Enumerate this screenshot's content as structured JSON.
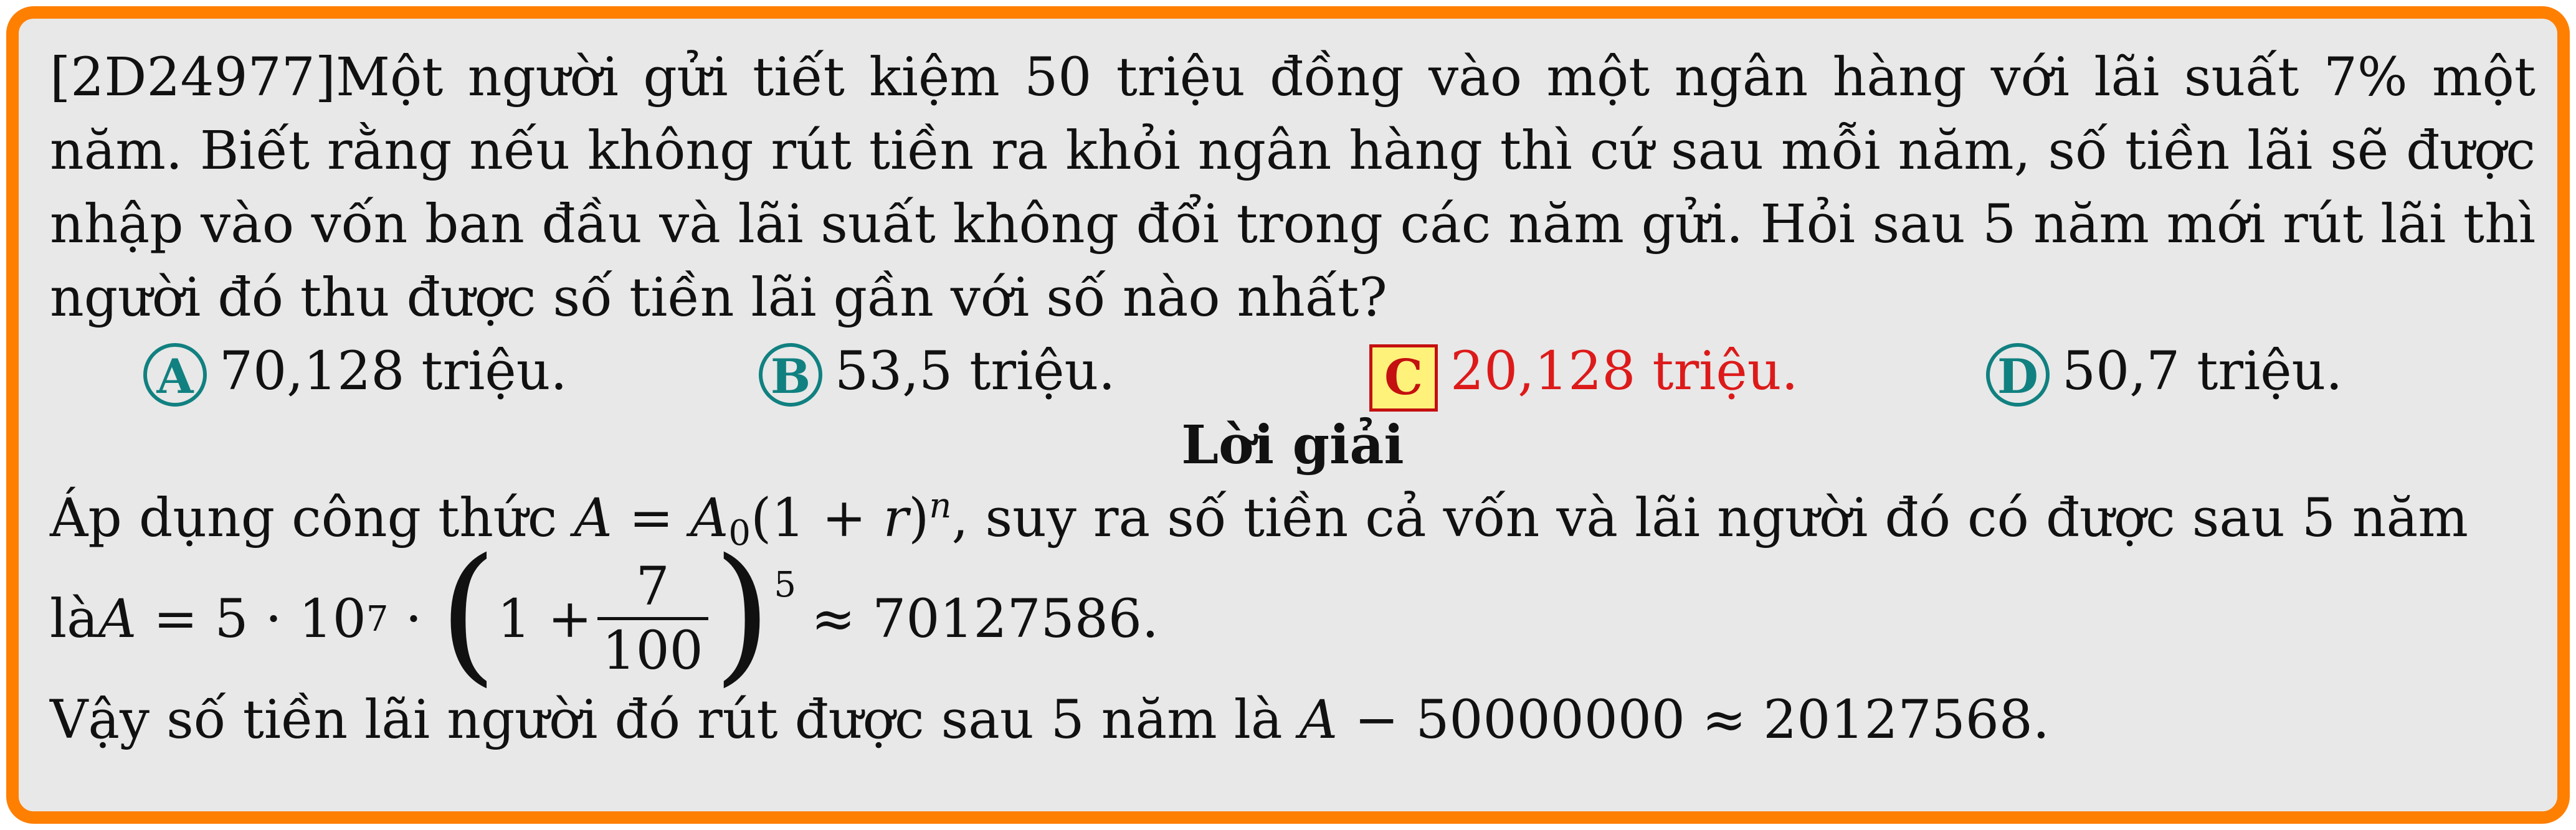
{
  "problem": {
    "text": "[2D24977]Một người gửi tiết kiệm 50 triệu đồng vào một ngân hàng với lãi suất 7% một năm. Biết rằng nếu không rút tiền ra khỏi ngân hàng thì cứ sau mỗi năm, số tiền lãi sẽ được nhập vào vốn ban đầu và lãi suất không đổi trong các năm gửi. Hỏi sau 5 năm mới rút lãi thì người đó thu được số tiền lãi gần với số nào nhất?"
  },
  "options": [
    {
      "letter": "A",
      "text": "70,128 triệu."
    },
    {
      "letter": "B",
      "text": "53,5 triệu."
    },
    {
      "letter": "C",
      "text": "20,128 triệu.",
      "correct": true
    },
    {
      "letter": "D",
      "text": "50,7 triệu."
    }
  ],
  "solution": {
    "title": "Lời giải",
    "line1_before": "Áp dụng công thức ",
    "line1_after": ", suy ra số tiền cả vốn và lãi người đó có được sau 5 năm",
    "line2_before": "là ",
    "line2_result": "≈ 70127586.",
    "line3_before": "Vậy số tiền lãi người đó rút được sau 5 năm là ",
    "line3_math": "A − 50000000 ≈ 20127568."
  },
  "colors": {
    "border": "#ff7f00",
    "background": "#e8e8e8",
    "option_circle": "#118080",
    "correct_text": "#dd1a1a",
    "correct_box_fill": "#fff27a"
  }
}
